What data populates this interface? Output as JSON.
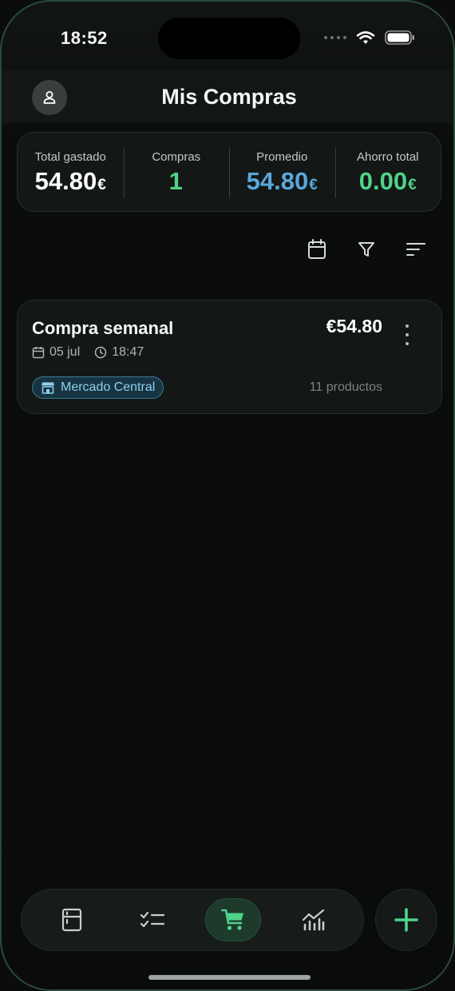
{
  "status_bar": {
    "time": "18:52"
  },
  "header": {
    "title": "Mis Compras"
  },
  "stats": [
    {
      "label": "Total gastado",
      "value": "54.80",
      "currency": "€",
      "color": "#ffffff"
    },
    {
      "label": "Compras",
      "value": "1",
      "currency": "",
      "color": "#4fd48a"
    },
    {
      "label": "Promedio",
      "value": "54.80",
      "currency": "€",
      "color": "#5aa8dc"
    },
    {
      "label": "Ahorro total",
      "value": "0.00",
      "currency": "€",
      "color": "#4fd48a"
    }
  ],
  "toolbar": {
    "icons": [
      "calendar-icon",
      "filter-icon",
      "sort-icon"
    ]
  },
  "purchases": [
    {
      "title": "Compra semanal",
      "amount": "€54.80",
      "date": "05 jul",
      "time": "18:47",
      "store": "Mercado Central",
      "products": "11 productos"
    }
  ],
  "bottom_nav": {
    "items": [
      "pantry-icon",
      "checklist-icon",
      "cart-icon",
      "stats-icon"
    ],
    "active": "cart-icon",
    "accent": "#4fd48a"
  },
  "fab": {
    "icon": "plus-icon"
  }
}
